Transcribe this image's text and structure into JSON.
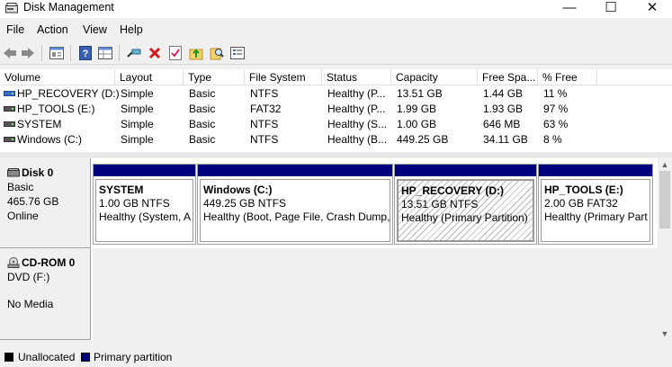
{
  "window": {
    "title": "Disk Management",
    "controls": {
      "minimize": "—",
      "maximize": "☐",
      "close": "✕"
    }
  },
  "menu": [
    "File",
    "Action",
    "View",
    "Help"
  ],
  "toolbar": {
    "icons": [
      "back-icon",
      "forward-icon",
      "properties-icon",
      "help-icon",
      "grid-icon",
      "connect-icon",
      "delete-icon",
      "checklist-icon",
      "import-icon",
      "search-icon",
      "settings-icon"
    ]
  },
  "volumes": {
    "columns": [
      "Volume",
      "Layout",
      "Type",
      "File System",
      "Status",
      "Capacity",
      "Free Spa...",
      "% Free"
    ],
    "rows": [
      {
        "volume": "HP_RECOVERY (D:)",
        "layout": "Simple",
        "type": "Basic",
        "fs": "NTFS",
        "status": "Healthy (P...",
        "capacity": "13.51 GB",
        "free": "1.44 GB",
        "pct": "11 %"
      },
      {
        "volume": "HP_TOOLS (E:)",
        "layout": "Simple",
        "type": "Basic",
        "fs": "FAT32",
        "status": "Healthy (P...",
        "capacity": "1.99 GB",
        "free": "1.93 GB",
        "pct": "97 %"
      },
      {
        "volume": "SYSTEM",
        "layout": "Simple",
        "type": "Basic",
        "fs": "NTFS",
        "status": "Healthy (S...",
        "capacity": "1.00 GB",
        "free": "646 MB",
        "pct": "63 %"
      },
      {
        "volume": "Windows (C:)",
        "layout": "Simple",
        "type": "Basic",
        "fs": "NTFS",
        "status": "Healthy (B...",
        "capacity": "449.25 GB",
        "free": "34.11 GB",
        "pct": "8 %"
      }
    ]
  },
  "disk0": {
    "name": "Disk 0",
    "type": "Basic",
    "size": "465.76 GB",
    "state": "Online",
    "partitions": [
      {
        "name": "SYSTEM",
        "size": "1.00 GB NTFS",
        "status": "Healthy (System, A"
      },
      {
        "name": "Windows  (C:)",
        "size": "449.25 GB NTFS",
        "status": "Healthy (Boot, Page File, Crash Dump,"
      },
      {
        "name": "HP_RECOVERY  (D:)",
        "size": "13.51 GB NTFS",
        "status": "Healthy (Primary Partition)"
      },
      {
        "name": "HP_TOOLS  (E:)",
        "size": "2.00 GB FAT32",
        "status": "Healthy (Primary Part"
      }
    ]
  },
  "cdrom0": {
    "name": "CD-ROM 0",
    "drive": "DVD (F:)",
    "media": "No Media"
  },
  "legend": {
    "unallocated": "Unallocated",
    "primary": "Primary partition",
    "unallocated_color": "#000000",
    "primary_color": "#00007f"
  }
}
